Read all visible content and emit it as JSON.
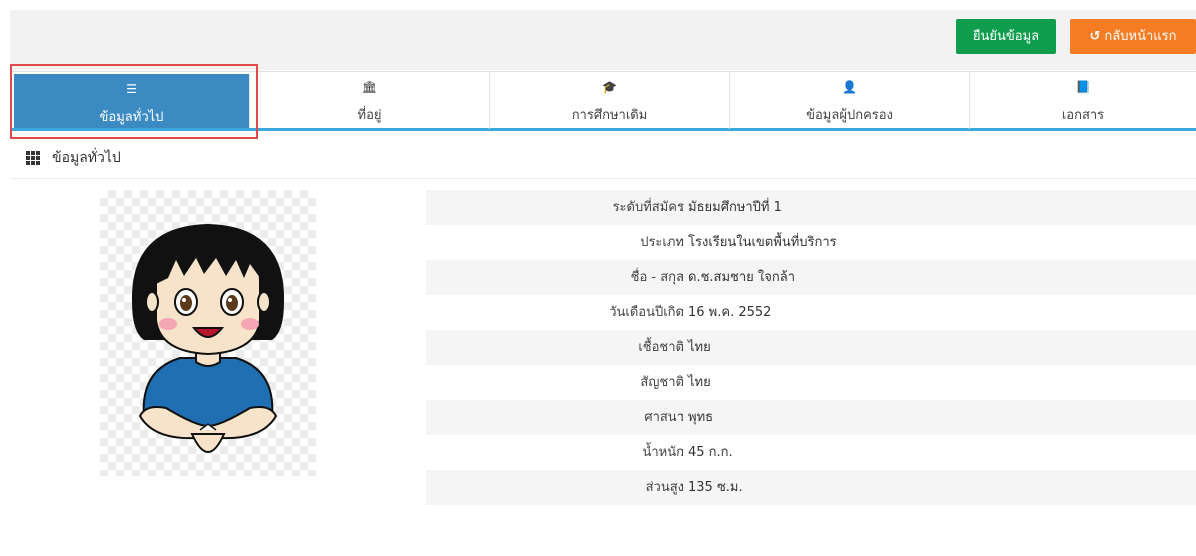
{
  "topbar": {
    "confirm_label": "ยืนยันข้อมูล",
    "home_icon": "undo-icon",
    "home_label": "กลับหน้าแรก"
  },
  "colors": {
    "confirm": "#109e4e",
    "home": "#f57c22",
    "active_tab": "#3b8ac2",
    "tab_underline": "#38a8de",
    "highlight": "#e04a4a"
  },
  "tabs": [
    {
      "icon": "list-icon",
      "label": "ข้อมูลทั่วไป",
      "active": true
    },
    {
      "icon": "bank-icon",
      "label": "ที่อยู่",
      "active": false
    },
    {
      "icon": "graduation-cap-icon",
      "label": "การศึกษาเดิม",
      "active": false
    },
    {
      "icon": "user-icon",
      "label": "ข้อมูลผู้ปกครอง",
      "active": false
    },
    {
      "icon": "book-icon",
      "label": "เอกสาร",
      "active": false
    }
  ],
  "section": {
    "icon": "grid-icon",
    "title": "ข้อมูลทั่วไป"
  },
  "fields": [
    {
      "label": "ระดับที่สมัคร",
      "value": "มัธยมศึกษาปีที่ 1"
    },
    {
      "label": "ประเภท",
      "value": "โรงเรียนในเขตพื้นที่บริการ"
    },
    {
      "label": "ชื่อ - สกุล",
      "value": "ด.ช.สมชาย ใจกล้า"
    },
    {
      "label": "วันเดือนปีเกิด",
      "value": "16 พ.ค. 2552"
    },
    {
      "label": "เชื้อชาติ",
      "value": "ไทย"
    },
    {
      "label": "สัญชาติ",
      "value": "ไทย"
    },
    {
      "label": "ศาสนา",
      "value": "พุทธ"
    },
    {
      "label": "น้ำหนัก",
      "value": "45 ก.ก."
    },
    {
      "label": "ส่วนสูง",
      "value": "135 ซ.ม."
    }
  ]
}
